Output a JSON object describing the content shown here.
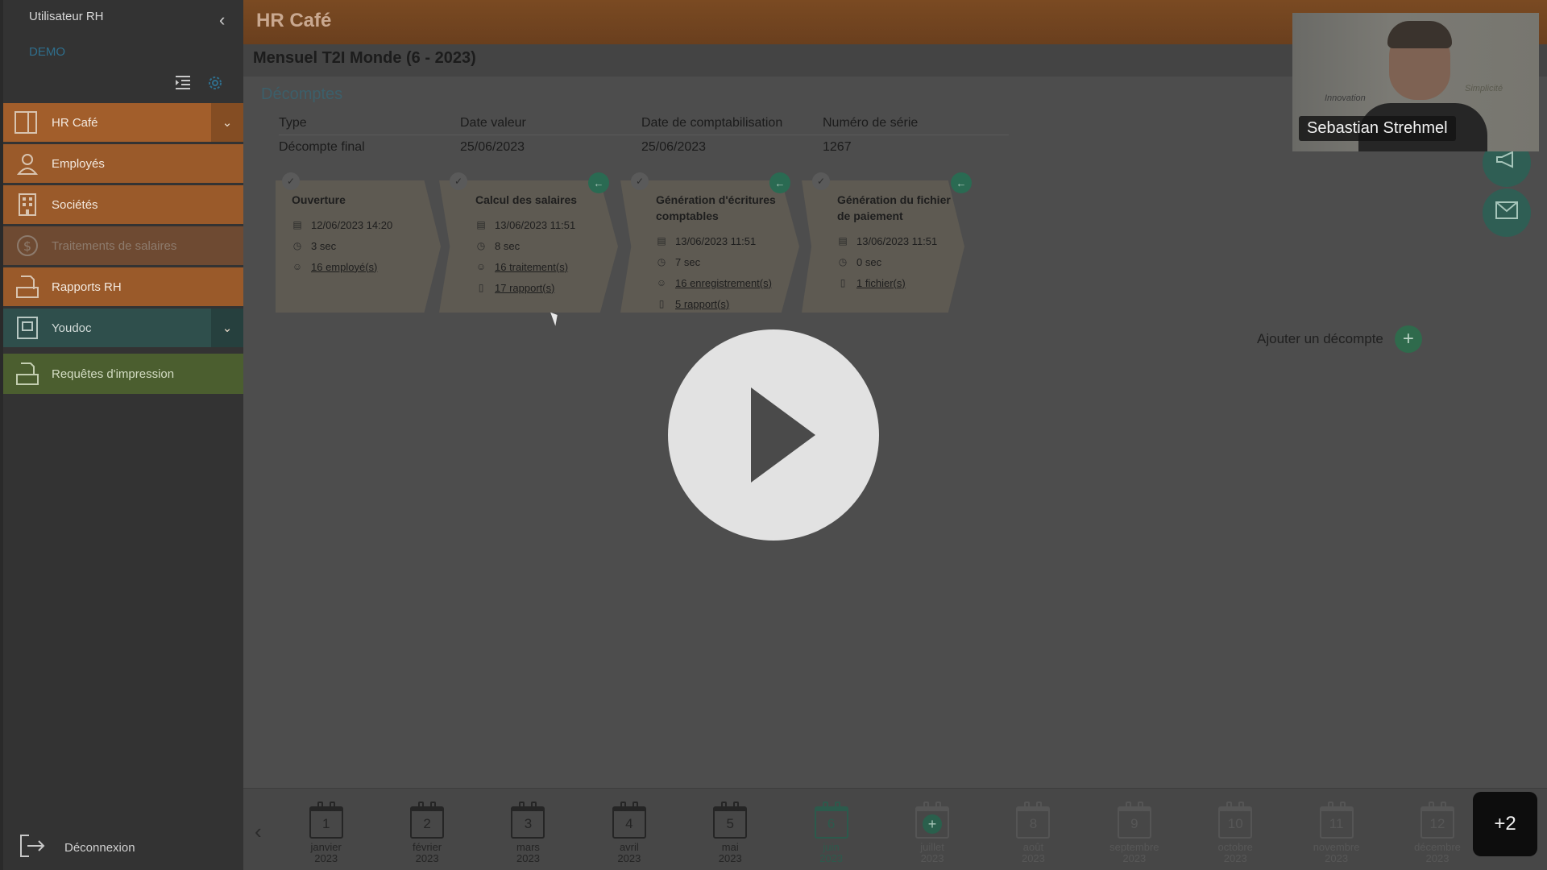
{
  "sidebar": {
    "user": "Utilisateur RH",
    "env": "DEMO",
    "menu": {
      "hrcafe": "HR Café",
      "employes": "Employés",
      "societes": "Sociétés",
      "traitements": "Traitements de salaires",
      "rapports": "Rapports RH",
      "youdoc": "Youdoc",
      "requetes": "Requêtes d'impression"
    },
    "logout": "Déconnexion"
  },
  "header": {
    "app_title": "HR Café",
    "period_title": "Mensuel T2I Monde (6 - 2023)"
  },
  "decomptes": {
    "section_title": "Décomptes",
    "columns": [
      "Type",
      "Date valeur",
      "Date de comptabilisation",
      "Numéro de série"
    ],
    "row": [
      "Décompte final",
      "25/06/2023",
      "25/06/2023",
      "1267"
    ]
  },
  "steps": [
    {
      "title": "Ouverture",
      "date": "12/06/2023 14:20",
      "duration": "3 sec",
      "link1": "16 employé(s)"
    },
    {
      "title": "Calcul des salaires",
      "date": "13/06/2023 11:51",
      "duration": "8 sec",
      "link1": "16 traitement(s)",
      "link2": "17 rapport(s)"
    },
    {
      "title": "Génération d'écritures comptables",
      "date": "13/06/2023 11:51",
      "duration": "7 sec",
      "link1": "16 enregistrement(s)",
      "link2": "5 rapport(s)"
    },
    {
      "title": "Génération du fichier de paiement",
      "date": "13/06/2023 11:51",
      "duration": "0 sec",
      "link1": "1 fichier(s)"
    }
  ],
  "add_decompte": "Ajouter un décompte",
  "webcam": {
    "name": "Sebastian Strehmel",
    "board_text_1": "Innovation",
    "board_text_2": "Simplicité"
  },
  "months": [
    {
      "num": "1",
      "name": "janvier",
      "year": "2023"
    },
    {
      "num": "2",
      "name": "février",
      "year": "2023"
    },
    {
      "num": "3",
      "name": "mars",
      "year": "2023"
    },
    {
      "num": "4",
      "name": "avril",
      "year": "2023"
    },
    {
      "num": "5",
      "name": "mai",
      "year": "2023"
    },
    {
      "num": "6",
      "name": "juin",
      "year": "2023"
    },
    {
      "num": "",
      "name": "juillet",
      "year": "2023"
    },
    {
      "num": "8",
      "name": "août",
      "year": "2023"
    },
    {
      "num": "9",
      "name": "septembre",
      "year": "2023"
    },
    {
      "num": "10",
      "name": "octobre",
      "year": "2023"
    },
    {
      "num": "11",
      "name": "novembre",
      "year": "2023"
    },
    {
      "num": "12",
      "name": "décembre",
      "year": "2023"
    }
  ],
  "overflow_badge": "+2"
}
